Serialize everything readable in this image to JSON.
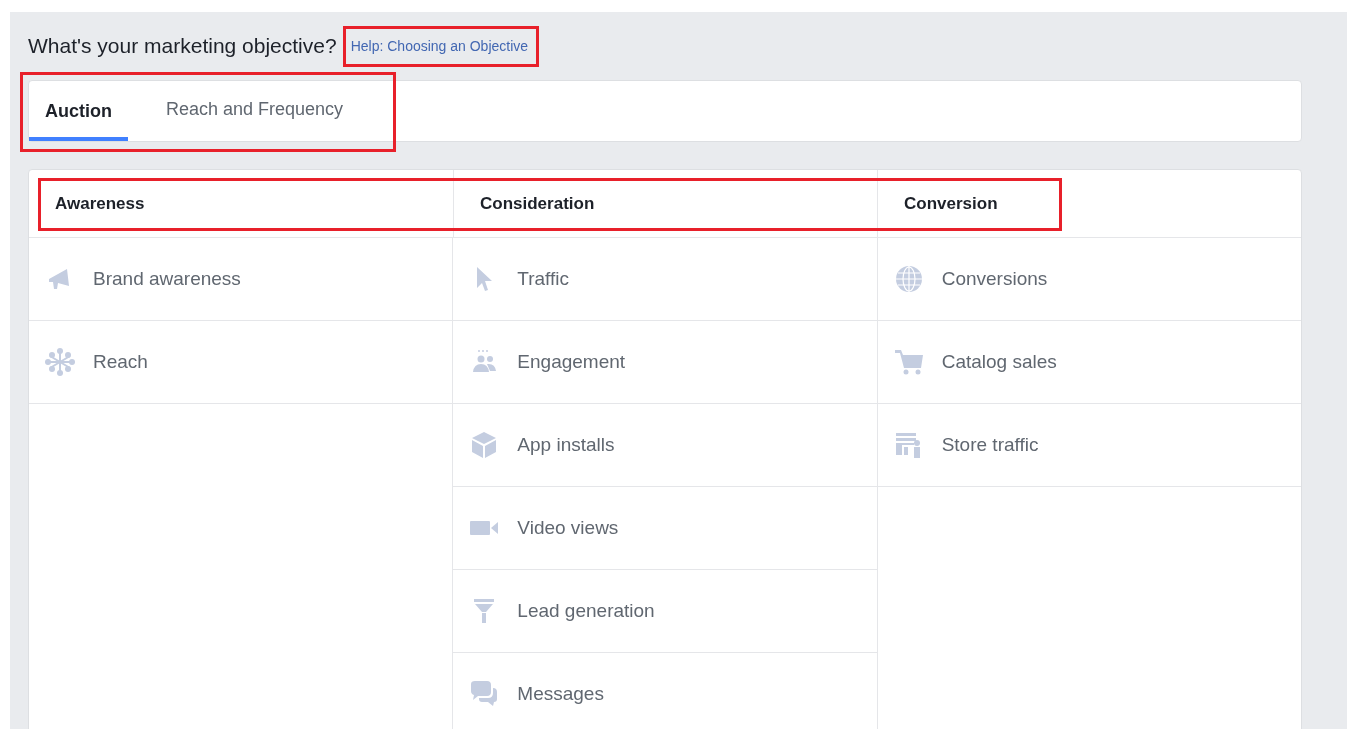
{
  "heading": "What's your marketing objective?",
  "help_link": {
    "text": "Help: Choosing an Objective",
    "highlighted": true
  },
  "tabs_highlighted": true,
  "tabs": [
    {
      "label": "Auction",
      "selected": true
    },
    {
      "label": "Reach and Frequency",
      "selected": false
    }
  ],
  "headers_highlighted": true,
  "columns": [
    {
      "title": "Awareness",
      "items": [
        "Brand awareness",
        "Reach"
      ]
    },
    {
      "title": "Consideration",
      "items": [
        "Traffic",
        "Engagement",
        "App installs",
        "Video views",
        "Lead generation",
        "Messages"
      ]
    },
    {
      "title": "Conversion",
      "items": [
        "Conversions",
        "Catalog sales",
        "Store traffic"
      ]
    }
  ]
}
